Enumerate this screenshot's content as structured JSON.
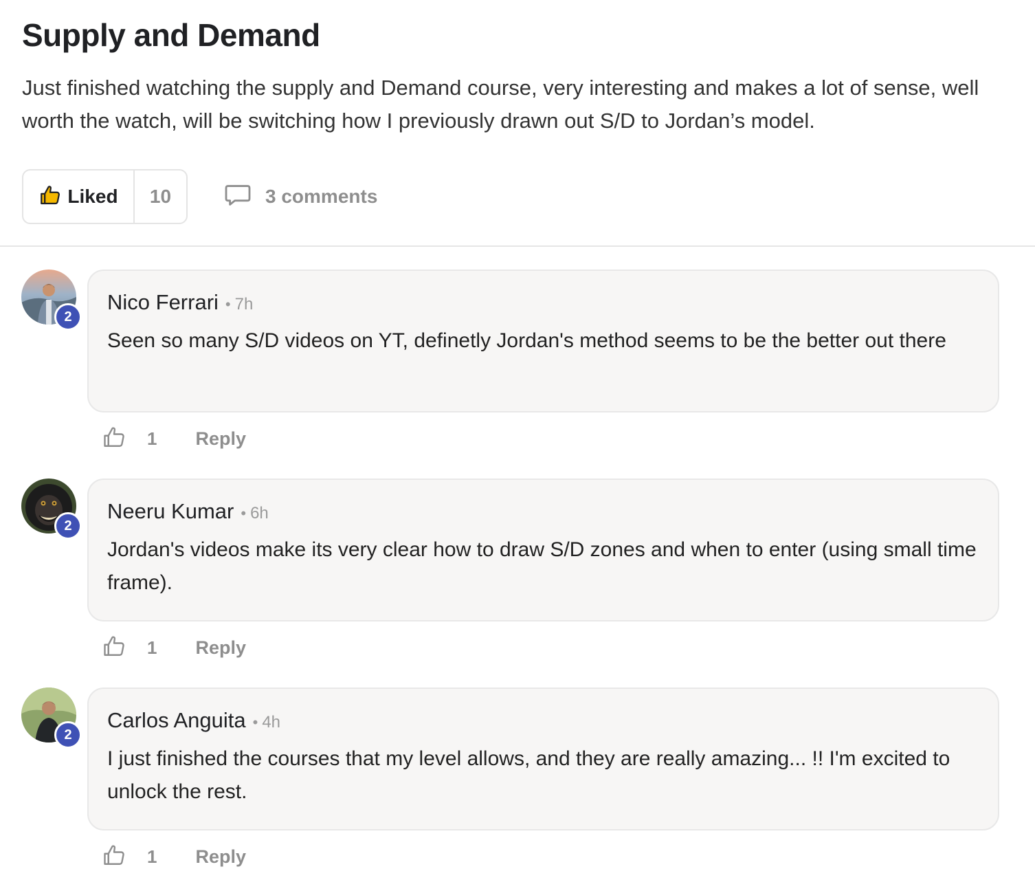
{
  "post": {
    "title": "Supply and Demand",
    "body": "Just finished watching the supply and Demand course, very interesting and makes a lot of sense, well worth the watch, will be switching how I previously drawn out S/D to Jordan’s model.",
    "liked_label": "Liked",
    "like_count": "10",
    "comments_label": "3 comments"
  },
  "comments": [
    {
      "author": "Nico Ferrari",
      "time": "7h",
      "text": "Seen so many S/D videos on YT, definetly Jordan's method seems to be the better out there",
      "level": "2",
      "likes": "1",
      "reply_label": "Reply"
    },
    {
      "author": "Neeru Kumar",
      "time": "6h",
      "text": "Jordan's videos make its very clear how to draw S/D zones and when to enter (using small time frame).",
      "level": "2",
      "likes": "1",
      "reply_label": "Reply"
    },
    {
      "author": "Carlos Anguita",
      "time": "4h",
      "text": "I just finished the courses that my level allows, and they are really amazing... !! I'm excited to unlock the rest.",
      "level": "2",
      "likes": "1",
      "reply_label": "Reply"
    }
  ],
  "colors": {
    "badge": "#3f51b5",
    "liked_icon": "#f5b800",
    "muted_text": "#8e8e8e",
    "bubble_bg": "#f7f6f5"
  },
  "icons": {
    "liked": "thumbs-up-filled-icon",
    "comments": "speech-bubble-icon",
    "comment_like": "thumbs-up-outline-icon"
  }
}
